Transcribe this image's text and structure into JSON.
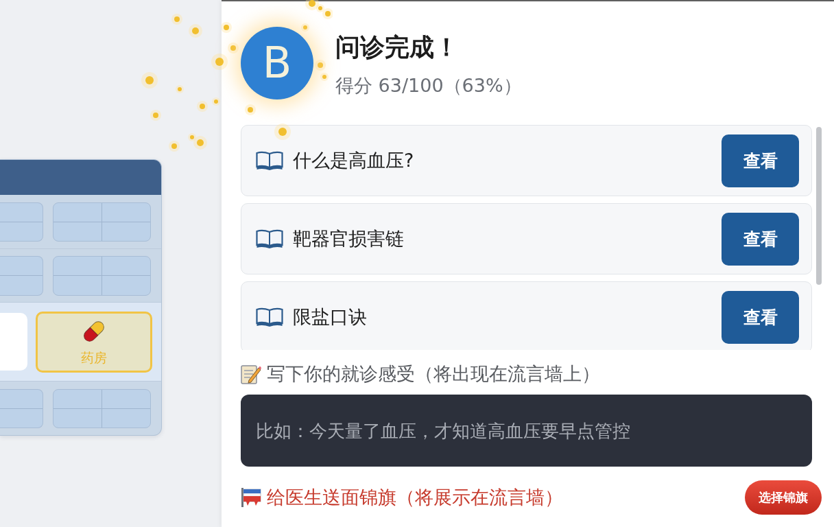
{
  "map_panel": {
    "rooms": [
      {
        "label": "药房",
        "selected": true
      }
    ]
  },
  "result": {
    "avatar_letter": "B",
    "title": "问诊完成！",
    "score": "得分 63/100（63%）"
  },
  "topics": [
    {
      "title": "什么是高血压?",
      "button": "查看"
    },
    {
      "title": "靶器官损害链",
      "button": "查看"
    },
    {
      "title": "限盐口诀",
      "button": "查看"
    }
  ],
  "feedback": {
    "label": "写下你的就诊感受（将出现在流言墙上）",
    "placeholder": "比如：今天量了血压，才知道高血压要早点管控"
  },
  "banner": {
    "label": "给医生送面锦旗（将展示在流言墙）",
    "button": "选择锦旗"
  }
}
